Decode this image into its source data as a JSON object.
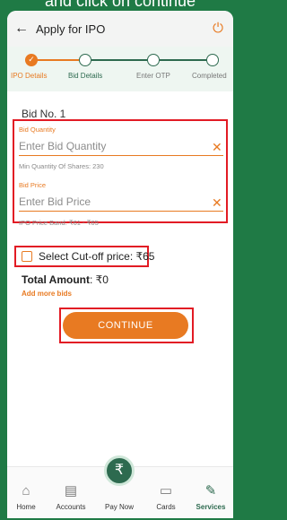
{
  "caption": "and click on continue",
  "appbar": {
    "back_icon": "←",
    "title": "Apply for IPO",
    "power_icon": "⏻"
  },
  "steps": [
    {
      "label": "IPO Details",
      "state": "done"
    },
    {
      "label": "Bid Details",
      "state": "current"
    },
    {
      "label": "Enter OTP",
      "state": "pending"
    },
    {
      "label": "Completed",
      "state": "pending"
    }
  ],
  "bid": {
    "number_label": "Bid No. 1",
    "quantity": {
      "label": "Bid Quantity",
      "placeholder": "Enter Bid Quantity",
      "hint": "Min Quantity Of Shares: 230"
    },
    "price": {
      "label": "Bid Price",
      "placeholder": "Enter Bid Price",
      "hint": "IPO Price Band: ₹61 - ₹65"
    },
    "clear_icon": "✕"
  },
  "cutoff": {
    "label": "Select Cut-off price: ₹65"
  },
  "total": {
    "label": "Total Amount",
    "value": ": ₹0"
  },
  "add_more": "Add more bids",
  "continue_label": "CONTINUE",
  "nav": [
    {
      "label": "Home",
      "icon": "⌂"
    },
    {
      "label": "Accounts",
      "icon": "▤"
    },
    {
      "label": "Pay Now",
      "icon": "₹"
    },
    {
      "label": "Cards",
      "icon": "▭"
    },
    {
      "label": "Services",
      "icon": "✎",
      "active": true
    }
  ],
  "colors": {
    "accent": "#e87a22",
    "brand": "#2d6a4f",
    "highlight": "#e21b24"
  }
}
